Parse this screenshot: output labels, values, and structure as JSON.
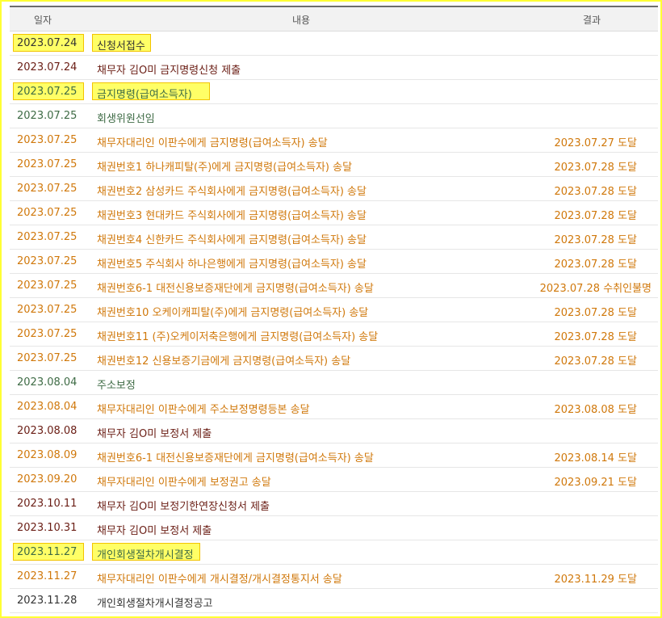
{
  "header": {
    "date": "일자",
    "content": "내용",
    "result": "결과"
  },
  "colors": {
    "orange": "#d0780b",
    "dark": "#333333",
    "green": "#3e6b45",
    "maroon": "#6a1d14",
    "highlight": "#ffff66",
    "frame": "#ffff33"
  },
  "rows": [
    {
      "date": "2023.07.24",
      "content": "신청서접수",
      "result": "",
      "tone": "dark",
      "highlighted": true
    },
    {
      "date": "2023.07.24",
      "content": "채무자 김O미 금지명령신청 제출",
      "result": "",
      "tone": "maroon",
      "highlighted": false
    },
    {
      "date": "2023.07.25",
      "content": "금지명령(급여소득자)",
      "result": "",
      "tone": "green",
      "highlighted": true
    },
    {
      "date": "2023.07.25",
      "content": "회생위원선임",
      "result": "",
      "tone": "green",
      "highlighted": false
    },
    {
      "date": "2023.07.25",
      "content": "채무자대리인 이판수에게 금지명령(급여소득자) 송달",
      "result": "2023.07.27 도달",
      "tone": "orange",
      "highlighted": false
    },
    {
      "date": "2023.07.25",
      "content": "채권번호1 하나캐피탈(주)에게 금지명령(급여소득자) 송달",
      "result": "2023.07.28 도달",
      "tone": "orange",
      "highlighted": false
    },
    {
      "date": "2023.07.25",
      "content": "채권번호2 삼성카드 주식회사에게 금지명령(급여소득자) 송달",
      "result": "2023.07.28 도달",
      "tone": "orange",
      "highlighted": false
    },
    {
      "date": "2023.07.25",
      "content": "채권번호3 현대카드 주식회사에게 금지명령(급여소득자) 송달",
      "result": "2023.07.28 도달",
      "tone": "orange",
      "highlighted": false
    },
    {
      "date": "2023.07.25",
      "content": "채권번호4 신한카드 주식회사에게 금지명령(급여소득자) 송달",
      "result": "2023.07.28 도달",
      "tone": "orange",
      "highlighted": false
    },
    {
      "date": "2023.07.25",
      "content": "채권번호5 주식회사 하나은행에게 금지명령(급여소득자) 송달",
      "result": "2023.07.28 도달",
      "tone": "orange",
      "highlighted": false
    },
    {
      "date": "2023.07.25",
      "content": "채권번호6-1 대전신용보증재단에게 금지명령(급여소득자) 송달",
      "result": "2023.07.28 수취인불명",
      "tone": "orange",
      "highlighted": false
    },
    {
      "date": "2023.07.25",
      "content": "채권번호10 오케이캐피탈(주)에게 금지명령(급여소득자) 송달",
      "result": "2023.07.28 도달",
      "tone": "orange",
      "highlighted": false
    },
    {
      "date": "2023.07.25",
      "content": "채권번호11 (주)오케이저축은행에게 금지명령(급여소득자) 송달",
      "result": "2023.07.28 도달",
      "tone": "orange",
      "highlighted": false
    },
    {
      "date": "2023.07.25",
      "content": "채권번호12 신용보증기금에게 금지명령(급여소득자) 송달",
      "result": "2023.07.28 도달",
      "tone": "orange",
      "highlighted": false
    },
    {
      "date": "2023.08.04",
      "content": "주소보정",
      "result": "",
      "tone": "green",
      "highlighted": false
    },
    {
      "date": "2023.08.04",
      "content": "채무자대리인 이판수에게 주소보정명령등본 송달",
      "result": "2023.08.08 도달",
      "tone": "orange",
      "highlighted": false
    },
    {
      "date": "2023.08.08",
      "content": "채무자 김O미 보정서 제출",
      "result": "",
      "tone": "maroon",
      "highlighted": false
    },
    {
      "date": "2023.08.09",
      "content": "채권번호6-1 대전신용보증재단에게 금지명령(급여소득자) 송달",
      "result": "2023.08.14 도달",
      "tone": "orange",
      "highlighted": false
    },
    {
      "date": "2023.09.20",
      "content": "채무자대리인 이판수에게 보정권고 송달",
      "result": "2023.09.21 도달",
      "tone": "orange",
      "highlighted": false
    },
    {
      "date": "2023.10.11",
      "content": "채무자 김O미 보정기한연장신청서 제출",
      "result": "",
      "tone": "maroon",
      "highlighted": false
    },
    {
      "date": "2023.10.31",
      "content": "채무자 김O미 보정서 제출",
      "result": "",
      "tone": "maroon",
      "highlighted": false
    },
    {
      "date": "2023.11.27",
      "content": "개인회생절차개시결정",
      "result": "",
      "tone": "green",
      "highlighted": true
    },
    {
      "date": "2023.11.27",
      "content": "채무자대리인 이판수에게 개시결정/개시결정통지서 송달",
      "result": "2023.11.29 도달",
      "tone": "orange",
      "highlighted": false
    },
    {
      "date": "2023.11.28",
      "content": "개인회생절차개시결정공고",
      "result": "",
      "tone": "dark",
      "highlighted": false
    }
  ]
}
